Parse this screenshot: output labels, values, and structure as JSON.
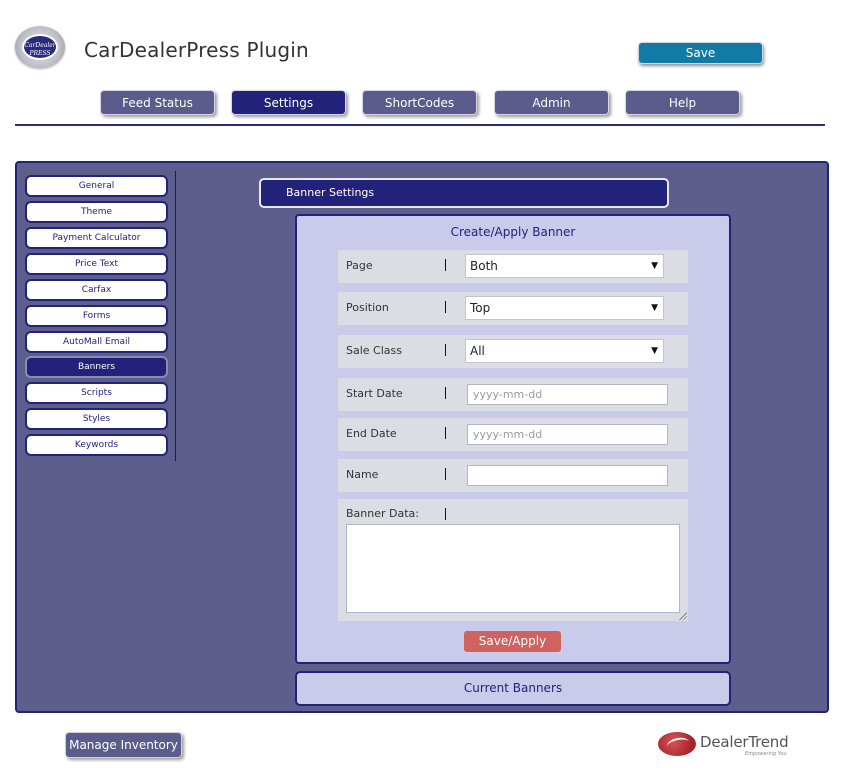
{
  "header": {
    "logo_text": "CarDealer PRESS",
    "title": "CarDealerPress Plugin",
    "save_label": "Save"
  },
  "nav": {
    "tabs": [
      {
        "label": "Feed Status",
        "active": false
      },
      {
        "label": "Settings",
        "active": true
      },
      {
        "label": "ShortCodes",
        "active": false
      },
      {
        "label": "Admin",
        "active": false
      },
      {
        "label": "Help",
        "active": false
      }
    ]
  },
  "sidebar": {
    "items": [
      {
        "label": "General",
        "active": false
      },
      {
        "label": "Theme",
        "active": false
      },
      {
        "label": "Payment Calculator",
        "active": false
      },
      {
        "label": "Price Text",
        "active": false
      },
      {
        "label": "Carfax",
        "active": false
      },
      {
        "label": "Forms",
        "active": false
      },
      {
        "label": "AutoMall Email",
        "active": false
      },
      {
        "label": "Banners",
        "active": true
      },
      {
        "label": "Scripts",
        "active": false
      },
      {
        "label": "Styles",
        "active": false
      },
      {
        "label": "Keywords",
        "active": false
      }
    ]
  },
  "section": {
    "title": "Banner Settings"
  },
  "form": {
    "title": "Create/Apply Banner",
    "page": {
      "label": "Page",
      "value": "Both"
    },
    "position": {
      "label": "Position",
      "value": "Top"
    },
    "sale_class": {
      "label": "Sale Class",
      "value": "All"
    },
    "start_date": {
      "label": "Start Date",
      "placeholder": "yyyy-mm-dd"
    },
    "end_date": {
      "label": "End Date",
      "placeholder": "yyyy-mm-dd"
    },
    "name": {
      "label": "Name",
      "value": ""
    },
    "banner_data": {
      "label": "Banner Data:",
      "value": ""
    },
    "apply_label": "Save/Apply"
  },
  "current": {
    "title": "Current Banners"
  },
  "footer": {
    "manage_label": "Manage Inventory",
    "brand_name": "DealerTrend",
    "brand_tagline": "Empowering You"
  },
  "colors": {
    "primary": "#22227a",
    "panel": "#5e5e8c",
    "form": "#cacaeb",
    "save": "#117aa7",
    "apply": "#d0625f"
  }
}
